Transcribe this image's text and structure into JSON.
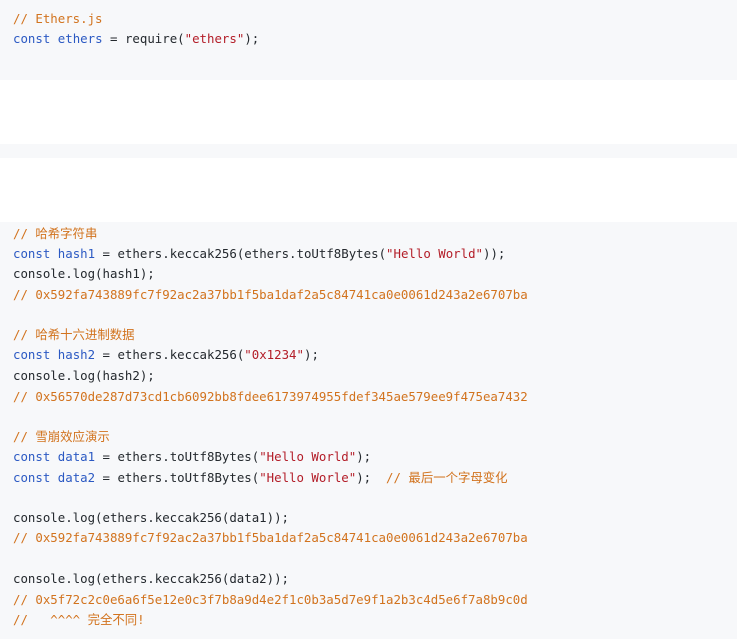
{
  "block1": {
    "comment": "// Ethers.js",
    "kw": "const",
    "var": "ethers",
    "op": " = ",
    "call": "require(",
    "str": "\"ethers\"",
    "end": ");"
  },
  "block3": {
    "c1": "// 哈希字符串",
    "l2_kw": "const",
    "l2_var": "hash1",
    "l2_mid": " = ethers.keccak256(ethers.toUtf8Bytes(",
    "l2_str": "\"Hello World\"",
    "l2_end": "));",
    "l3": "console.log(hash1);",
    "c4": "// 0x592fa743889fc7f92ac2a37bb1f5ba1daf2a5c84741ca0e0061d243a2e6707ba",
    "c6": "// 哈希十六进制数据",
    "l7_kw": "const",
    "l7_var": "hash2",
    "l7_mid": " = ethers.keccak256(",
    "l7_str": "\"0x1234\"",
    "l7_end": ");",
    "l8": "console.log(hash2);",
    "c9": "// 0x56570de287d73cd1cb6092bb8fdee6173974955fdef345ae579ee9f475ea7432",
    "c11": "// 雪崩效应演示",
    "l12_kw": "const",
    "l12_var": "data1",
    "l12_mid": " = ethers.toUtf8Bytes(",
    "l12_str": "\"Hello World\"",
    "l12_end": ");",
    "l13_kw": "const",
    "l13_var": "data2",
    "l13_mid": " = ethers.toUtf8Bytes(",
    "l13_str": "\"Hello Worle\"",
    "l13_end": ");  ",
    "l13_comment": "// 最后一个字母变化",
    "l15": "console.log(ethers.keccak256(data1));",
    "c16": "// 0x592fa743889fc7f92ac2a37bb1f5ba1daf2a5c84741ca0e0061d243a2e6707ba",
    "l18": "console.log(ethers.keccak256(data2));",
    "c19": "// 0x5f72c2c0e6a6f5e12e0c3f7b8a9d4e2f1c0b3a5d7e9f1a2b3c4d5e6f7a8b9c0d",
    "c20": "//   ^^^^ 完全不同!"
  }
}
